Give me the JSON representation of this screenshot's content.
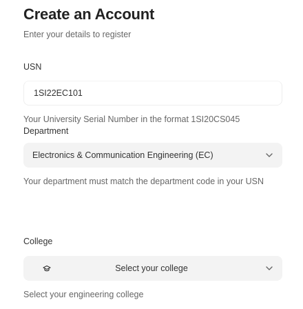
{
  "form": {
    "title": "Create an Account",
    "subtitle": "Enter your details to register",
    "usn": {
      "label": "USN",
      "value": "1SI22EC101",
      "helper": "Your University Serial Number in the format 1SI20CS045"
    },
    "department": {
      "label": "Department",
      "selected": "Electronics & Communication Engineering (EC)",
      "helper": "Your department must match the department code in your USN"
    },
    "college": {
      "label": "College",
      "placeholder": "Select your college",
      "icon": "school-icon",
      "helper": "Select your engineering college"
    }
  }
}
